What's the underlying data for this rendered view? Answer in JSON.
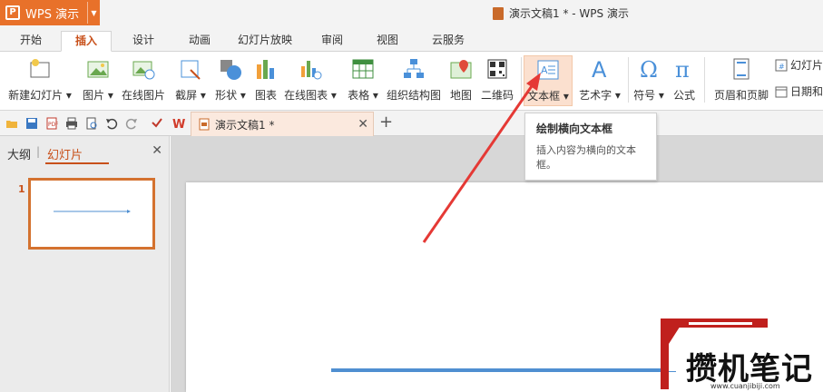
{
  "app": {
    "name": "WPS 演示"
  },
  "window": {
    "title": "演示文稿1 * - WPS 演示"
  },
  "menu_tabs": [
    "开始",
    "插入",
    "设计",
    "动画",
    "幻灯片放映",
    "审阅",
    "视图",
    "云服务"
  ],
  "active_tab": "插入",
  "ribbon": {
    "new_slide": "新建幻灯片",
    "picture": "图片",
    "online_picture": "在线图片",
    "screenshot": "截屏",
    "shape": "形状",
    "chart": "图表",
    "online_chart": "在线图表",
    "table": "表格",
    "org_chart": "组织结构图",
    "map": "地图",
    "qrcode": "二维码",
    "textbox": "文本框",
    "wordart": "艺术字",
    "symbol": "符号",
    "formula": "公式",
    "header_footer": "页眉和页脚",
    "slide_number": "幻灯片",
    "date_time": "日期和"
  },
  "doc_tab": {
    "label": "演示文稿1 *"
  },
  "left_panel": {
    "outline_tab": "大纲",
    "slides_tab": "幻灯片",
    "slide_number": "1"
  },
  "tooltip": {
    "title": "绘制横向文本框",
    "body": "插入内容为横向的文本框。"
  },
  "watermark": {
    "text": "攒机笔记",
    "url": "www.cuanjibiji.com"
  },
  "colors": {
    "accent": "#e8712a",
    "tab_active": "#c8501a",
    "arrow": "#e53935",
    "line": "#4f8fd1"
  }
}
